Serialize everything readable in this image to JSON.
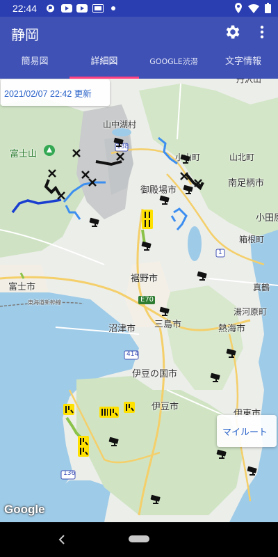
{
  "status_bar": {
    "time": "22:44",
    "icons": [
      "notification-icon",
      "youtube-icon",
      "youtube-icon",
      "sim-icon",
      "dot-icon",
      "location-icon",
      "wifi-icon",
      "battery-icon"
    ]
  },
  "app_bar": {
    "title": "静岡",
    "actions": [
      "settings-icon",
      "more-vert-icon"
    ],
    "colors": {
      "primary": "#3f51b5",
      "status": "#2a3eb1",
      "accent": "#ff4081"
    }
  },
  "tabs": [
    {
      "label": "簡易図",
      "active": false
    },
    {
      "label": "詳細図",
      "active": true
    },
    {
      "label": "GOOGLE渋滞",
      "active": false
    },
    {
      "label": "文字情報",
      "active": false
    }
  ],
  "map": {
    "timestamp_label": "2021/02/07 22:42 更新",
    "my_route_button": "マイルート",
    "attribution": "Google",
    "places": [
      {
        "id": "fujinomiya-partial",
        "text": "丹沢山"
      },
      {
        "id": "yamanakako",
        "text": "山中湖村"
      },
      {
        "id": "fujisan",
        "text": "富士山"
      },
      {
        "id": "oyama",
        "text": "小山町"
      },
      {
        "id": "yamakita",
        "text": "山北町"
      },
      {
        "id": "gotemba",
        "text": "御殿場市"
      },
      {
        "id": "minamiashigara",
        "text": "南足柄市"
      },
      {
        "id": "odawara",
        "text": "小田原"
      },
      {
        "id": "hakone",
        "text": "箱根町"
      },
      {
        "id": "susono",
        "text": "裾野市"
      },
      {
        "id": "fuji",
        "text": "富士市"
      },
      {
        "id": "manazuru",
        "text": "真鶴"
      },
      {
        "id": "yugawara",
        "text": "湯河原町"
      },
      {
        "id": "e70",
        "text": "E70"
      },
      {
        "id": "numazu",
        "text": "沼津市"
      },
      {
        "id": "mishima",
        "text": "三島市"
      },
      {
        "id": "atami",
        "text": "熱海市"
      },
      {
        "id": "izunokuni",
        "text": "伊豆の国市"
      },
      {
        "id": "izu",
        "text": "伊豆市"
      },
      {
        "id": "ito",
        "text": "伊東市"
      },
      {
        "id": "r414",
        "text": "414"
      },
      {
        "id": "r138",
        "text": "138"
      },
      {
        "id": "r1",
        "text": "1"
      },
      {
        "id": "r136",
        "text": "136"
      },
      {
        "id": "shinkansen",
        "text": "東海道新幹線"
      }
    ]
  },
  "nav_bar": {
    "buttons": [
      "back-icon",
      "home-pill"
    ]
  }
}
